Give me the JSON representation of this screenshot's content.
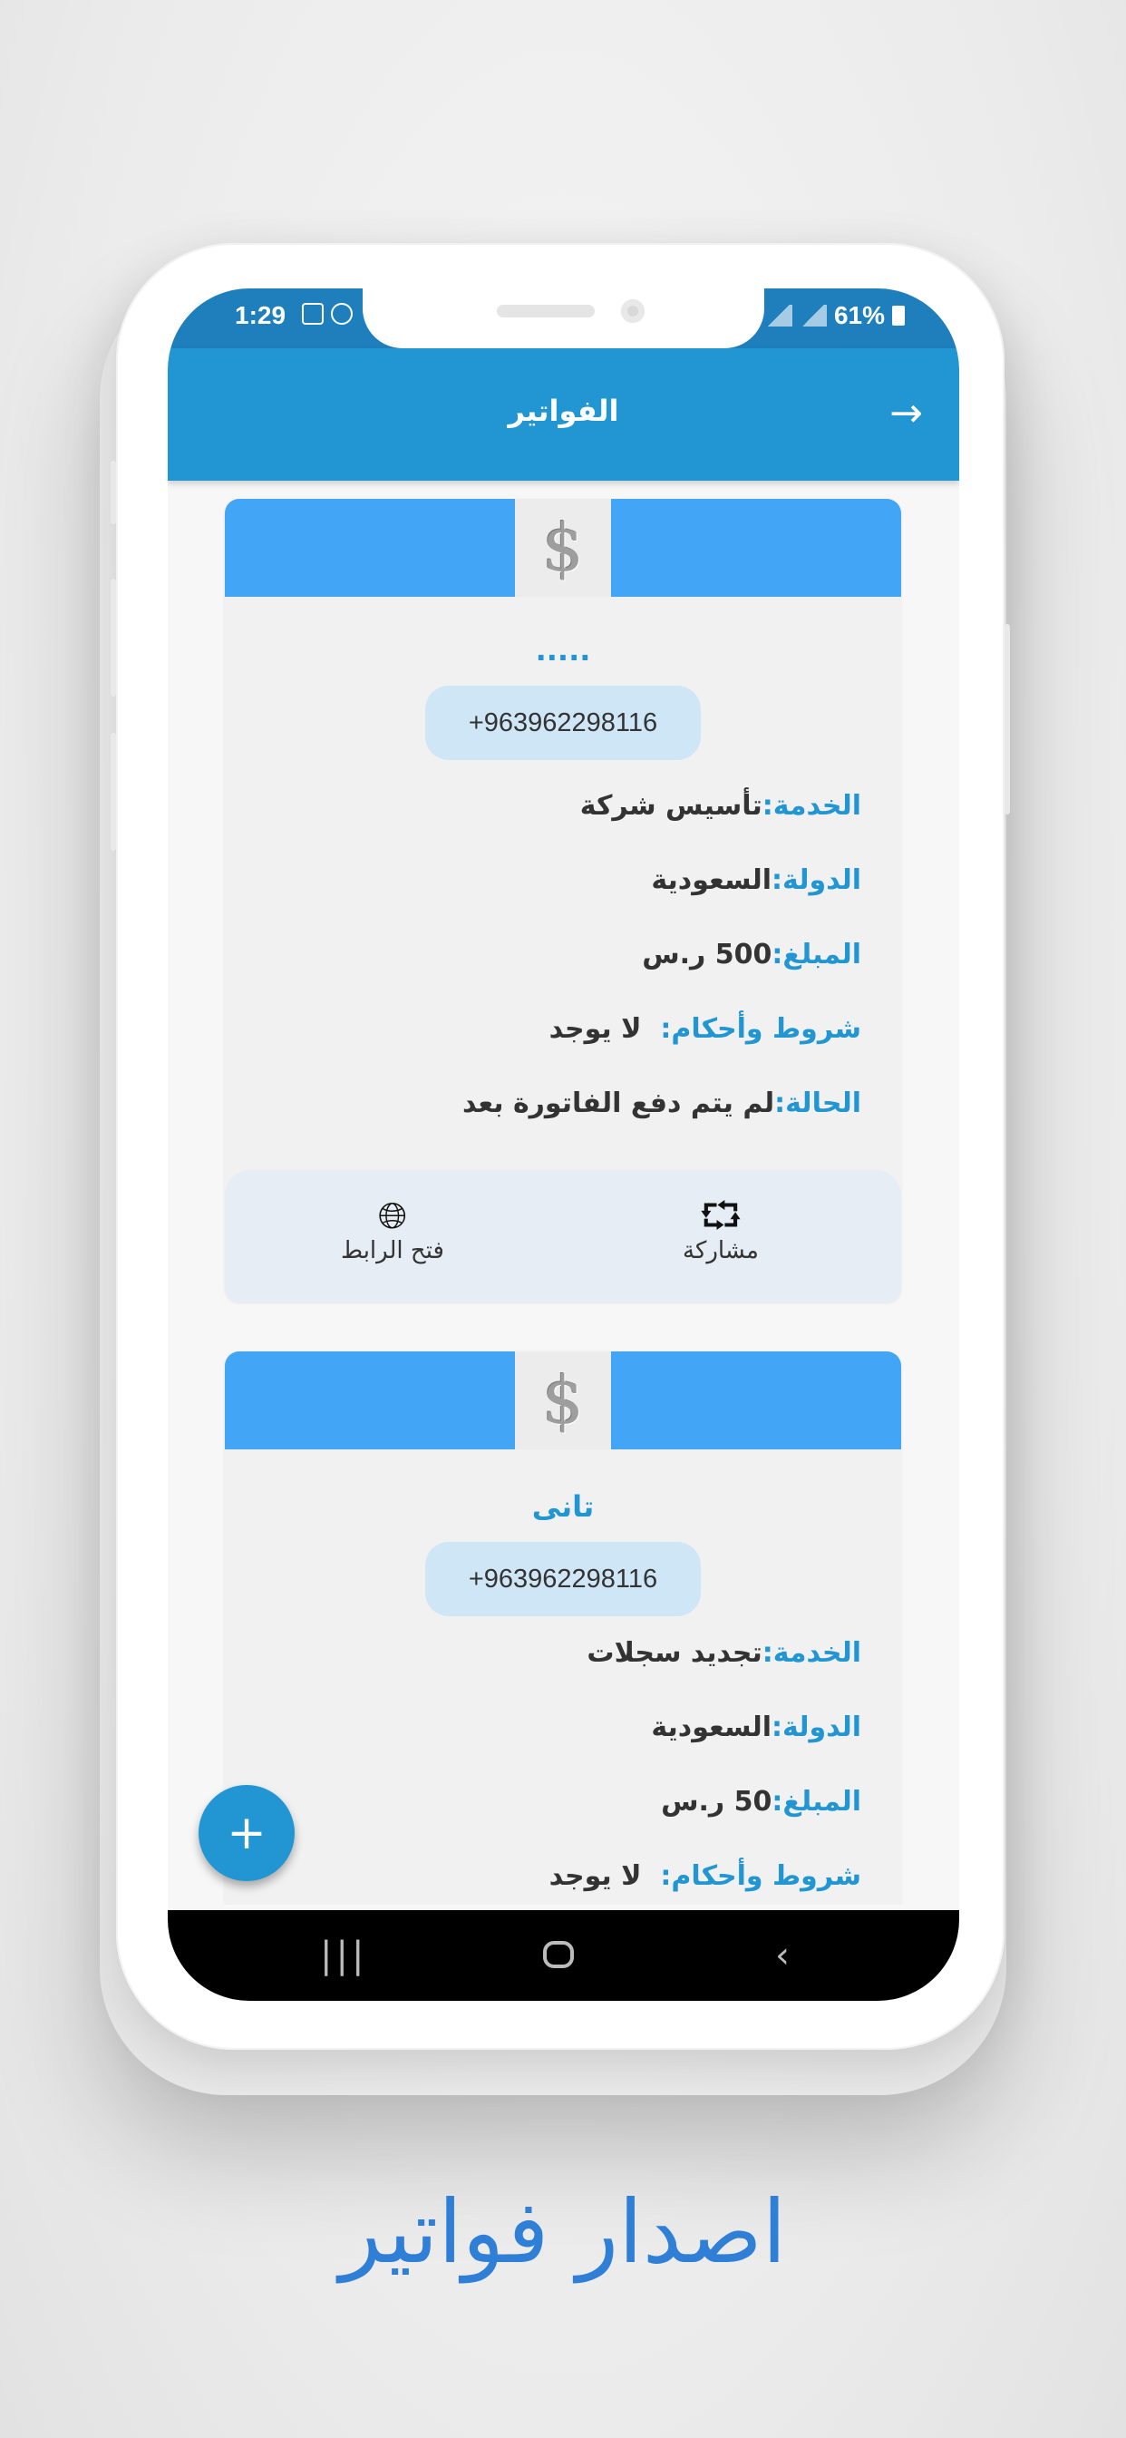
{
  "status_bar": {
    "time": "1:29",
    "battery": "61%"
  },
  "app_bar": {
    "title": "الفواتير",
    "back_icon": "arrow-right-icon"
  },
  "invoices": [
    {
      "name": ".....",
      "phone": "+963962298116",
      "fields": [
        {
          "label": "الخدمة:",
          "value": "تأسيس شركة"
        },
        {
          "label": "الدولة:",
          "value": "السعودية"
        },
        {
          "label": "المبلغ:",
          "value": "500 ر.س"
        },
        {
          "label": "شروط وأحكام:",
          "value": "لا يوجد"
        },
        {
          "label": "الحالة:",
          "value": "لم يتم دفع الفاتورة بعد"
        }
      ],
      "actions": {
        "share": "مشاركة",
        "open_link": "فتح الرابط"
      }
    },
    {
      "name": "تانى",
      "phone": "+963962298116",
      "fields": [
        {
          "label": "الخدمة:",
          "value": "تجديد سجلات"
        },
        {
          "label": "الدولة:",
          "value": "السعودية"
        },
        {
          "label": "المبلغ:",
          "value": "50 ر.س"
        },
        {
          "label": "شروط وأحكام:",
          "value": "لا يوجد"
        }
      ]
    }
  ],
  "fab": {
    "label": "+"
  },
  "caption": "اصدار فواتير",
  "colors": {
    "primary": "#2196d3",
    "header_blue": "#42a5f5",
    "caption": "#2f7fd6"
  }
}
